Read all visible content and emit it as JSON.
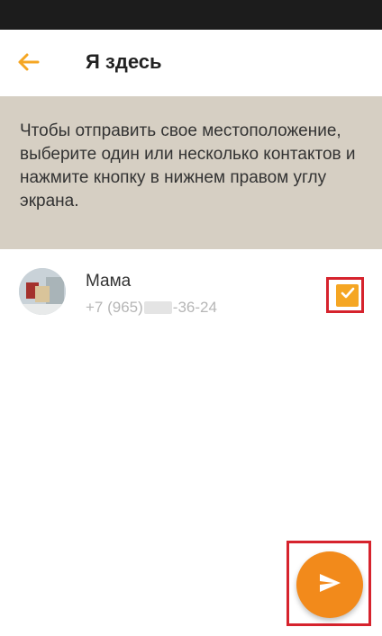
{
  "app": {
    "title": "Я здесь"
  },
  "info": {
    "text": "Чтобы отправить свое местоположение, выберите один или несколько контактов и нажмите кнопку в нижнем правом углу экрана."
  },
  "contacts": [
    {
      "name": "Мама",
      "phone_prefix": "+7 (965) ",
      "phone_suffix": "-36-24",
      "selected": true
    }
  ],
  "icons": {
    "back": "arrow-left-icon",
    "send": "send-icon",
    "check": "check-icon"
  },
  "colors": {
    "accent": "#f5a623",
    "fab": "#f28a1b",
    "info_background": "#d6cfc3",
    "highlight": "#d6232d"
  }
}
